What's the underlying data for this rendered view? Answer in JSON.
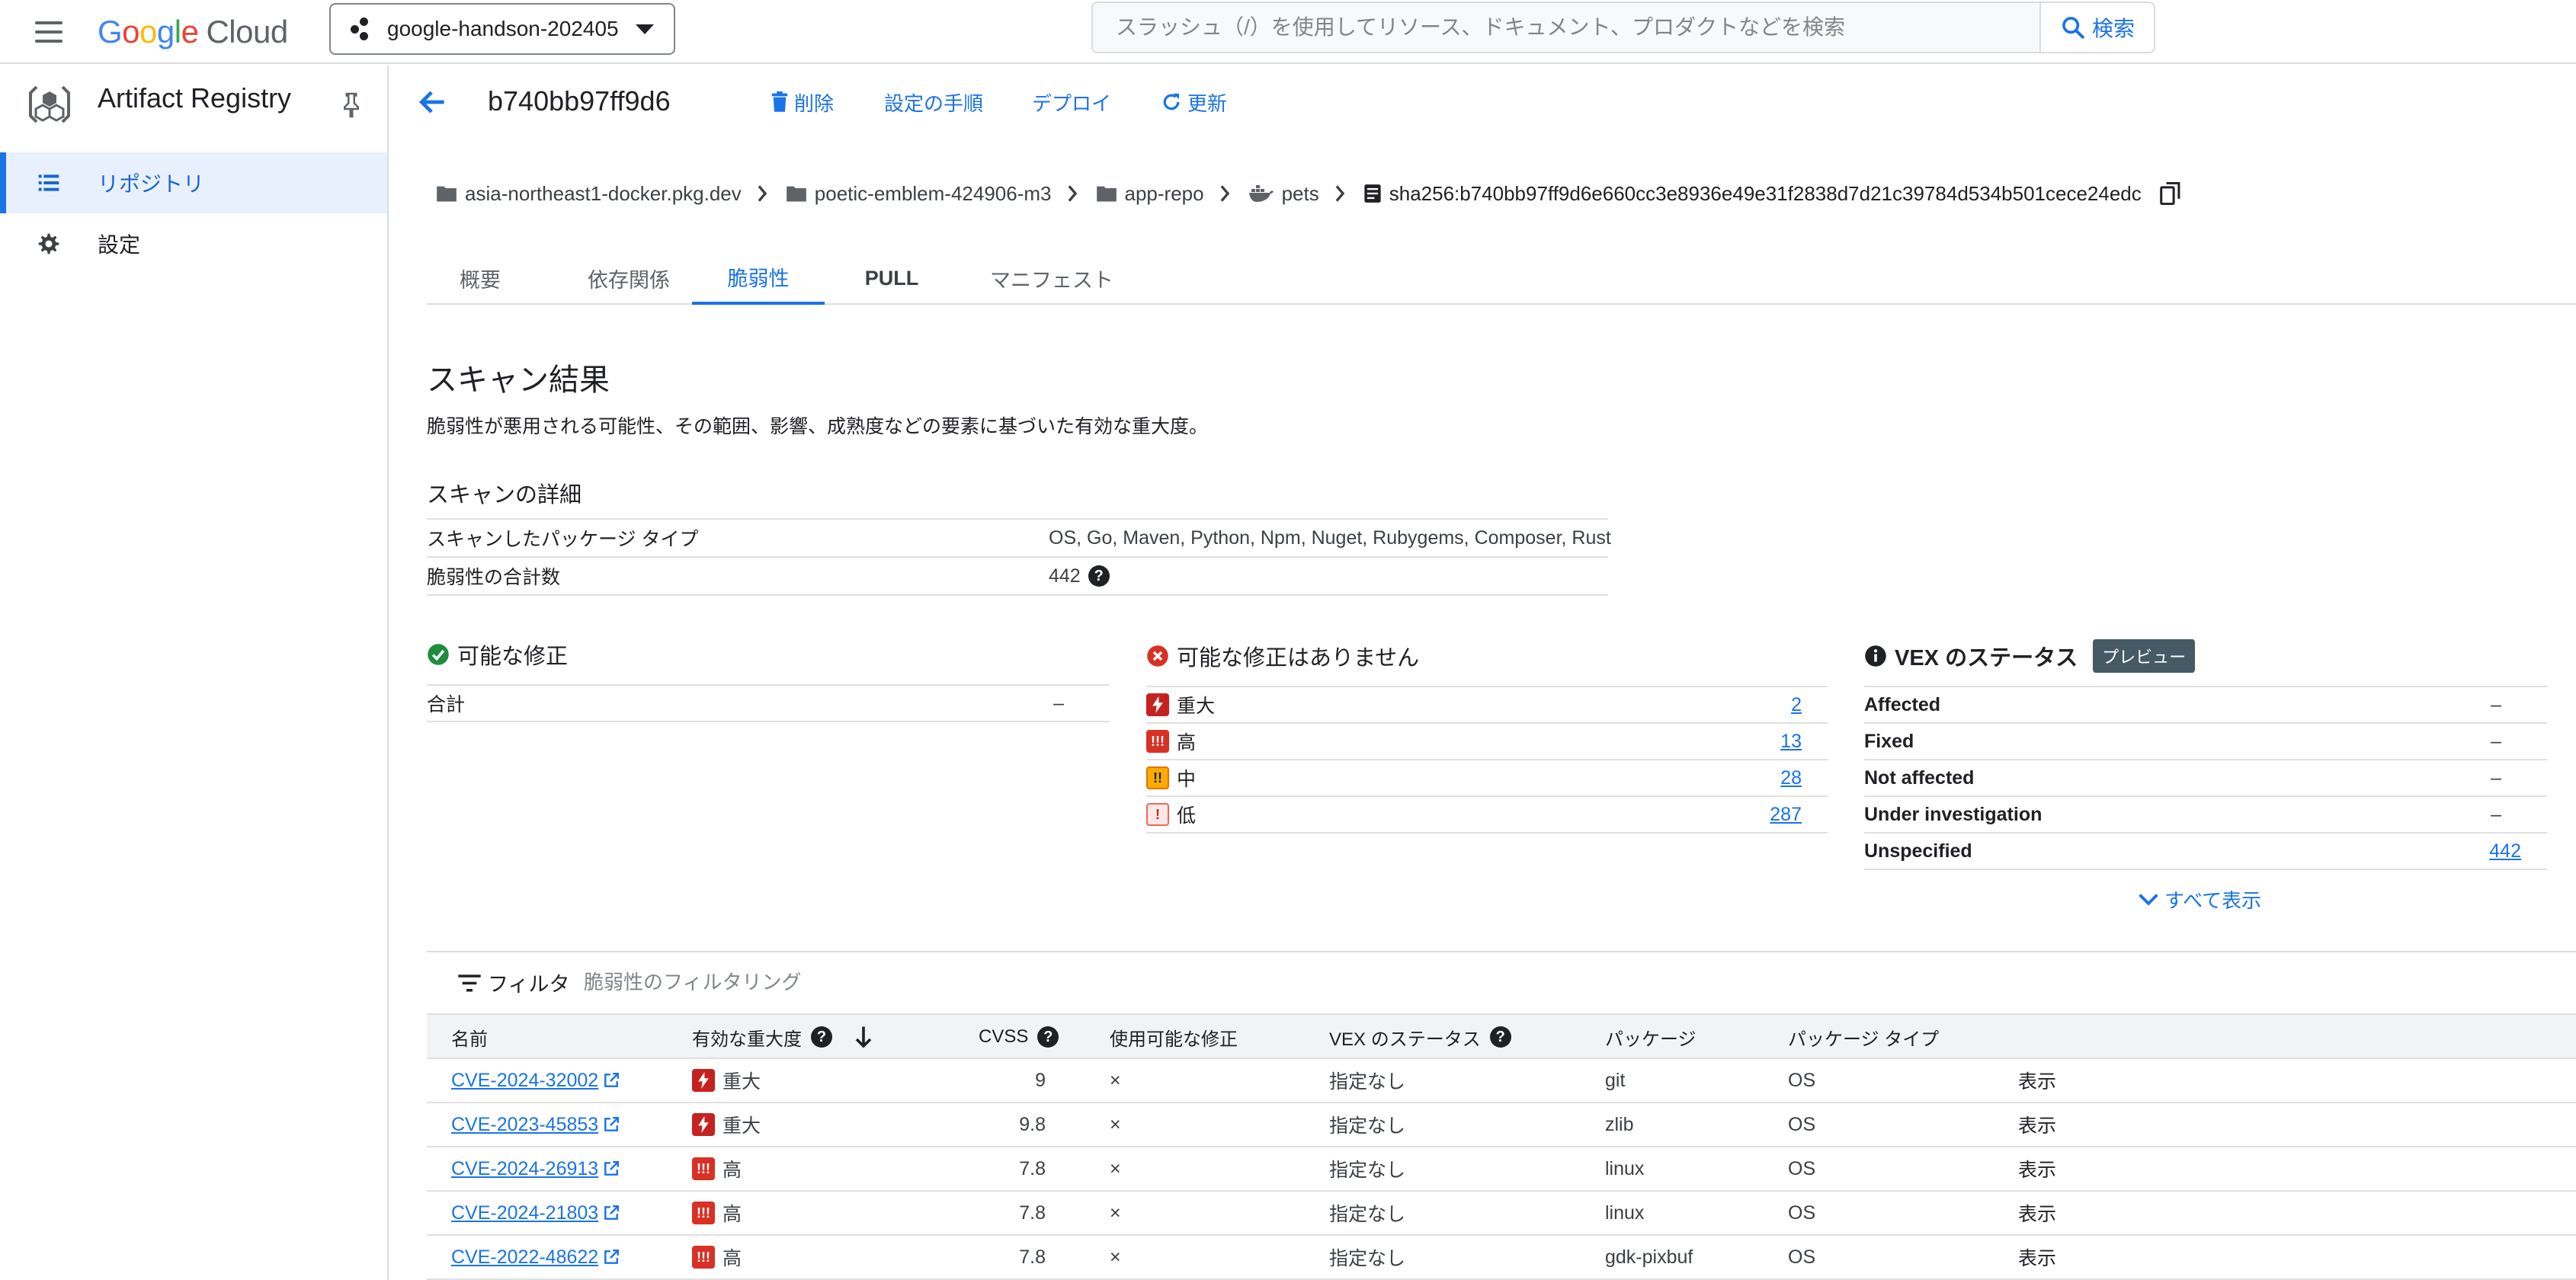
{
  "topbar": {
    "logo": {
      "google": "Google",
      "cloud": "Cloud"
    },
    "project": "google-handson-202405",
    "search_placeholder": "スラッシュ（/）を使用してリソース、ドキュメント、プロダクトなどを検索",
    "search_button": "検索"
  },
  "sidebar": {
    "product": "Artifact Registry",
    "items": [
      {
        "label": "リポジトリ",
        "icon": "list-icon",
        "active": true
      },
      {
        "label": "設定",
        "icon": "gear-icon",
        "active": false
      }
    ]
  },
  "header": {
    "title": "b740bb97ff9d6",
    "actions": {
      "delete": "削除",
      "setup": "設定の手順",
      "deploy": "デプロイ",
      "refresh": "更新"
    }
  },
  "breadcrumb": [
    {
      "label": "asia-northeast1-docker.pkg.dev",
      "icon": "folder-icon"
    },
    {
      "label": "poetic-emblem-424906-m3",
      "icon": "folder-icon"
    },
    {
      "label": "app-repo",
      "icon": "folder-icon"
    },
    {
      "label": "pets",
      "icon": "docker-icon"
    },
    {
      "label": "sha256:b740bb97ff9d6e660cc3e8936e49e31f2838d7d21c39784d534b501cece24edc",
      "icon": "file-icon"
    }
  ],
  "tabs": [
    {
      "label": "概要"
    },
    {
      "label": "依存関係"
    },
    {
      "label": "脆弱性",
      "active": true
    },
    {
      "label": "PULL"
    },
    {
      "label": "マニフェスト"
    }
  ],
  "scan": {
    "title": "スキャン結果",
    "description": "脆弱性が悪用される可能性、その範囲、影響、成熟度などの要素に基づいた有効な重大度。",
    "details_title": "スキャンの詳細",
    "package_types_label": "スキャンしたパッケージ タイプ",
    "package_types_value": "OS, Go, Maven, Python, Npm, Nuget, Rubygems, Composer, Rust",
    "total_label": "脆弱性の合計数",
    "total_value": "442"
  },
  "fixes": {
    "title": "可能な修正",
    "rows": [
      {
        "label": "合計",
        "value": "–"
      }
    ]
  },
  "no_fixes": {
    "title": "可能な修正はありません",
    "rows": [
      {
        "label": "重大",
        "value": "2",
        "severity": "critical"
      },
      {
        "label": "高",
        "value": "13",
        "severity": "high"
      },
      {
        "label": "中",
        "value": "28",
        "severity": "medium"
      },
      {
        "label": "低",
        "value": "287",
        "severity": "low"
      }
    ]
  },
  "vex": {
    "title": "VEX のステータス",
    "badge": "プレビュー",
    "rows": [
      {
        "label": "Affected",
        "value": "–"
      },
      {
        "label": "Fixed",
        "value": "–"
      },
      {
        "label": "Not affected",
        "value": "–"
      },
      {
        "label": "Under investigation",
        "value": "–"
      },
      {
        "label": "Unspecified",
        "value": "442"
      }
    ],
    "show_all": "すべて表示"
  },
  "filter": {
    "label": "フィルタ",
    "placeholder": "脆弱性のフィルタリング"
  },
  "table": {
    "headers": {
      "name": "名前",
      "severity": "有効な重大度",
      "cvss": "CVSS",
      "fix": "使用可能な修正",
      "vex": "VEX のステータス",
      "package": "パッケージ",
      "package_type": "パッケージ タイプ"
    },
    "rows": [
      {
        "name": "CVE-2024-32002",
        "severity": "重大",
        "sev": "critical",
        "cvss": "9",
        "fix": "×",
        "vex": "指定なし",
        "package": "git",
        "type": "OS",
        "action": "表示"
      },
      {
        "name": "CVE-2023-45853",
        "severity": "重大",
        "sev": "critical",
        "cvss": "9.8",
        "fix": "×",
        "vex": "指定なし",
        "package": "zlib",
        "type": "OS",
        "action": "表示"
      },
      {
        "name": "CVE-2024-26913",
        "severity": "高",
        "sev": "high",
        "cvss": "7.8",
        "fix": "×",
        "vex": "指定なし",
        "package": "linux",
        "type": "OS",
        "action": "表示"
      },
      {
        "name": "CVE-2024-21803",
        "severity": "高",
        "sev": "high",
        "cvss": "7.8",
        "fix": "×",
        "vex": "指定なし",
        "package": "linux",
        "type": "OS",
        "action": "表示"
      },
      {
        "name": "CVE-2022-48622",
        "severity": "高",
        "sev": "high",
        "cvss": "7.8",
        "fix": "×",
        "vex": "指定なし",
        "package": "gdk-pixbuf",
        "type": "OS",
        "action": "表示"
      }
    ]
  },
  "colors": {
    "accent": "#1a73e8",
    "critical": "#c5221f",
    "high": "#d93025",
    "medium": "#f9ab00",
    "success": "#1e8e3e"
  }
}
